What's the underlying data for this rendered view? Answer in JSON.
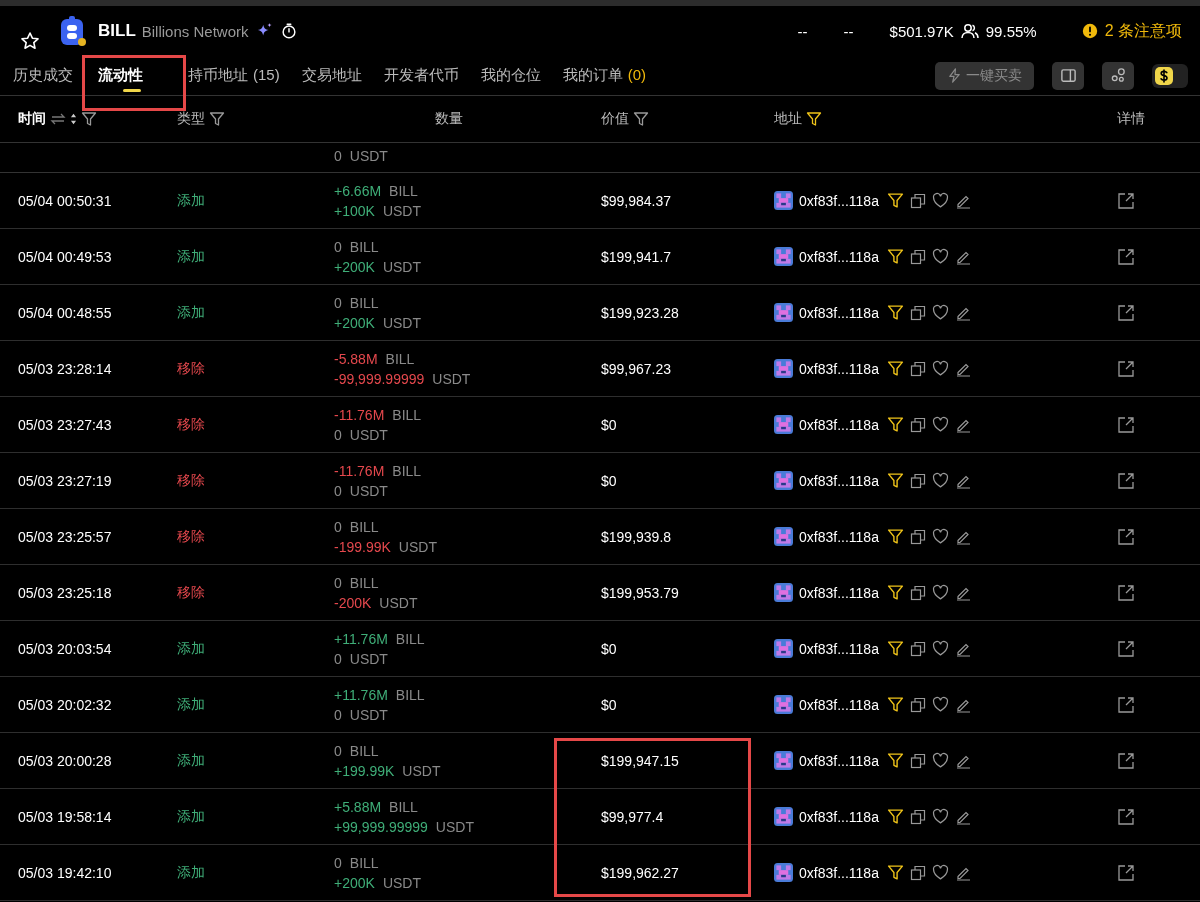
{
  "token": {
    "symbol": "BILL",
    "name": "Billions Network"
  },
  "stats": [
    "--",
    "--",
    "$501.97K"
  ],
  "holders_share": "99.55%",
  "warning": {
    "count": "2",
    "label": "条注意项"
  },
  "tabs": [
    {
      "label": "历史成交",
      "selected": false
    },
    {
      "label": "流动性",
      "selected": true
    },
    {
      "label": "持币地址",
      "count": "(15)",
      "count_accent": false,
      "selected": false
    },
    {
      "label": "交易地址",
      "selected": false
    },
    {
      "label": "开发者代币",
      "selected": false
    },
    {
      "label": "我的仓位",
      "selected": false
    },
    {
      "label": "我的订单",
      "count": "(0)",
      "count_accent": true,
      "selected": false
    }
  ],
  "quick_trade_button": "一键买卖",
  "currency_toggle": {
    "on": true
  },
  "columns": [
    {
      "label": "时间",
      "sortable": true,
      "filter_active": false
    },
    {
      "label": "类型",
      "filter_active": false
    },
    {
      "label": "数量"
    },
    {
      "label": "价值",
      "filter_active": false
    },
    {
      "label": "地址",
      "filter_active": true
    },
    {
      "label": "详情"
    }
  ],
  "partial_row": {
    "amount": "0",
    "unit": "USDT"
  },
  "rows": [
    {
      "time": "05/04 00:50:31",
      "kind": "add",
      "type": "添加",
      "amounts": [
        {
          "value": "+6.66M",
          "unit": "BILL",
          "kind": "up"
        },
        {
          "value": "+100K",
          "unit": "USDT",
          "kind": "up"
        }
      ],
      "value": "$99,984.37",
      "address": "0xf83f...118a"
    },
    {
      "time": "05/04 00:49:53",
      "kind": "add",
      "type": "添加",
      "amounts": [
        {
          "value": "0",
          "unit": "BILL",
          "kind": "none"
        },
        {
          "value": "+200K",
          "unit": "USDT",
          "kind": "up"
        }
      ],
      "value": "$199,941.7",
      "address": "0xf83f...118a"
    },
    {
      "time": "05/04 00:48:55",
      "kind": "add",
      "type": "添加",
      "amounts": [
        {
          "value": "0",
          "unit": "BILL",
          "kind": "none"
        },
        {
          "value": "+200K",
          "unit": "USDT",
          "kind": "up"
        }
      ],
      "value": "$199,923.28",
      "address": "0xf83f...118a"
    },
    {
      "time": "05/03 23:28:14",
      "kind": "remove",
      "type": "移除",
      "amounts": [
        {
          "value": "-5.88M",
          "unit": "BILL",
          "kind": "down"
        },
        {
          "value": "-99,999.99999",
          "unit": "USDT",
          "kind": "down"
        }
      ],
      "value": "$99,967.23",
      "address": "0xf83f...118a"
    },
    {
      "time": "05/03 23:27:43",
      "kind": "remove",
      "type": "移除",
      "amounts": [
        {
          "value": "-11.76M",
          "unit": "BILL",
          "kind": "down"
        },
        {
          "value": "0",
          "unit": "USDT",
          "kind": "none"
        }
      ],
      "value": "$0",
      "address": "0xf83f...118a"
    },
    {
      "time": "05/03 23:27:19",
      "kind": "remove",
      "type": "移除",
      "amounts": [
        {
          "value": "-11.76M",
          "unit": "BILL",
          "kind": "down"
        },
        {
          "value": "0",
          "unit": "USDT",
          "kind": "none"
        }
      ],
      "value": "$0",
      "address": "0xf83f...118a"
    },
    {
      "time": "05/03 23:25:57",
      "kind": "remove",
      "type": "移除",
      "amounts": [
        {
          "value": "0",
          "unit": "BILL",
          "kind": "none"
        },
        {
          "value": "-199.99K",
          "unit": "USDT",
          "kind": "down"
        }
      ],
      "value": "$199,939.8",
      "address": "0xf83f...118a"
    },
    {
      "time": "05/03 23:25:18",
      "kind": "remove",
      "type": "移除",
      "amounts": [
        {
          "value": "0",
          "unit": "BILL",
          "kind": "none"
        },
        {
          "value": "-200K",
          "unit": "USDT",
          "kind": "down"
        }
      ],
      "value": "$199,953.79",
      "address": "0xf83f...118a"
    },
    {
      "time": "05/03 20:03:54",
      "kind": "add",
      "type": "添加",
      "amounts": [
        {
          "value": "+11.76M",
          "unit": "BILL",
          "kind": "up"
        },
        {
          "value": "0",
          "unit": "USDT",
          "kind": "none"
        }
      ],
      "value": "$0",
      "address": "0xf83f...118a"
    },
    {
      "time": "05/03 20:02:32",
      "kind": "add",
      "type": "添加",
      "amounts": [
        {
          "value": "+11.76M",
          "unit": "BILL",
          "kind": "up"
        },
        {
          "value": "0",
          "unit": "USDT",
          "kind": "none"
        }
      ],
      "value": "$0",
      "address": "0xf83f...118a"
    },
    {
      "time": "05/03 20:00:28",
      "kind": "add",
      "type": "添加",
      "amounts": [
        {
          "value": "0",
          "unit": "BILL",
          "kind": "none"
        },
        {
          "value": "+199.99K",
          "unit": "USDT",
          "kind": "up"
        }
      ],
      "value": "$199,947.15",
      "address": "0xf83f...118a"
    },
    {
      "time": "05/03 19:58:14",
      "kind": "add",
      "type": "添加",
      "amounts": [
        {
          "value": "+5.88M",
          "unit": "BILL",
          "kind": "up"
        },
        {
          "value": "+99,999.99999",
          "unit": "USDT",
          "kind": "up"
        }
      ],
      "value": "$99,977.4",
      "address": "0xf83f...118a"
    },
    {
      "time": "05/03 19:42:10",
      "kind": "add",
      "type": "添加",
      "amounts": [
        {
          "value": "0",
          "unit": "BILL",
          "kind": "none"
        },
        {
          "value": "+200K",
          "unit": "USDT",
          "kind": "up"
        }
      ],
      "value": "$199,962.27",
      "address": "0xf83f...118a"
    }
  ]
}
